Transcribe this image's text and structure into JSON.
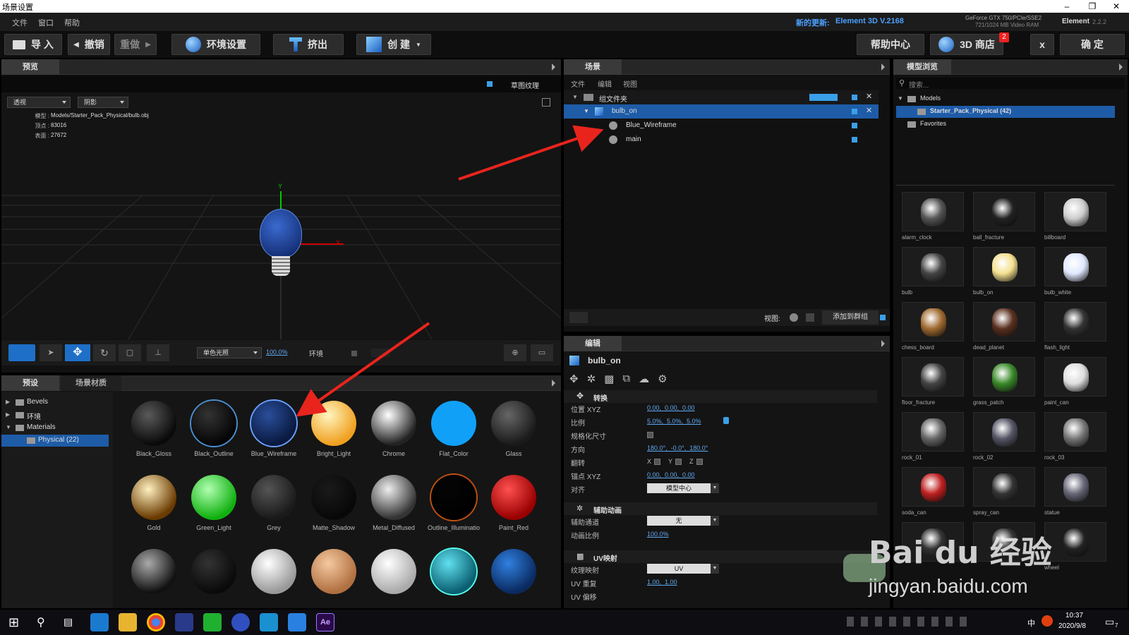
{
  "window": {
    "title": "场景设置",
    "min": "–",
    "restore": "❐",
    "close": "✕"
  },
  "menu": {
    "items": [
      "文件",
      "窗口",
      "帮助"
    ],
    "update_label": "新的更新:",
    "update_version": "Element 3D V.2168",
    "gpu_line1": "GeForce GTX 750/PCIe/SSE2",
    "gpu_line2": "721/1024 MB Video RAM",
    "app": "Element",
    "app_version": "2.2.2"
  },
  "toolbar": {
    "import": "导 入",
    "undo": "撤销",
    "redo": "重做",
    "env": "环境设置",
    "extrude": "挤出",
    "create": "创 建",
    "help": "帮助中心",
    "store": "3D 商店",
    "store_badge": "2",
    "close": "x",
    "ok": "确 定"
  },
  "preview": {
    "tab": "预览",
    "draft_texture": "草图纹理",
    "view_mode": "透视",
    "shadow_mode": "阴影",
    "info": [
      {
        "k": "模型 :",
        "v": "Models/Starter_Pack_Physical/bulb.obj"
      },
      {
        "k": "顶点 :",
        "v": "83016"
      },
      {
        "k": "表面 :",
        "v": "27672"
      }
    ],
    "axis_y": "Y",
    "axis_x": "X",
    "light_mode": "单色光照",
    "zoom": "100.0%",
    "env_label": "环境"
  },
  "presets": {
    "tabs": [
      "预设",
      "场景材质"
    ],
    "tree": [
      {
        "label": "Bevels",
        "open": false
      },
      {
        "label": "环境",
        "open": false
      },
      {
        "label": "Materials",
        "open": true
      },
      {
        "label": "Physical (22)",
        "child": true,
        "selected": true
      }
    ],
    "materials": [
      {
        "name": "Black_Gloss",
        "c1": "#5a5a5a",
        "c2": "#0a0a0a"
      },
      {
        "name": "Black_Outline",
        "c1": "#333",
        "c2": "#050505",
        "ring": "#4a8fd0"
      },
      {
        "name": "Blue_Wireframe",
        "c1": "#2a4e9a",
        "c2": "#0a1a40",
        "ring": "#6aa0ff"
      },
      {
        "name": "Bright_Light",
        "c1": "#fff5c0",
        "c2": "#f0a020"
      },
      {
        "name": "Chrome",
        "c1": "#ffffff",
        "c2": "#222"
      },
      {
        "name": "Flat_Color",
        "c1": "#10a0f8",
        "c2": "#10a0f8"
      },
      {
        "name": "Glass",
        "c1": "#666",
        "c2": "#1a1a1a"
      },
      {
        "name": "Gold",
        "c1": "#fff0c0",
        "c2": "#6a3a00"
      },
      {
        "name": "Green_Light",
        "c1": "#b0ffb0",
        "c2": "#10b010"
      },
      {
        "name": "Grey",
        "c1": "#555",
        "c2": "#1a1a1a"
      },
      {
        "name": "Matte_Shadow",
        "c1": "#1a1a1a",
        "c2": "#080808"
      },
      {
        "name": "Metal_Diffused",
        "c1": "#eee",
        "c2": "#333"
      },
      {
        "name": "Outline_Illuminatio",
        "c1": "#050505",
        "c2": "#000",
        "ring": "#c05010"
      },
      {
        "name": "Paint_Red",
        "c1": "#ff5050",
        "c2": "#900"
      },
      {
        "name": "",
        "c1": "#aaa",
        "c2": "#111"
      },
      {
        "name": "",
        "c1": "#333",
        "c2": "#0a0a0a"
      },
      {
        "name": "",
        "c1": "#fff",
        "c2": "#999"
      },
      {
        "name": "",
        "c1": "#f5c8a0",
        "c2": "#b07040"
      },
      {
        "name": "",
        "c1": "#fff",
        "c2": "#aaa"
      },
      {
        "name": "",
        "c1": "#60e0f0",
        "c2": "#0a6070",
        "ring": "#5fe"
      },
      {
        "name": "",
        "c1": "#3080e0",
        "c2": "#0a2a60"
      }
    ]
  },
  "scene": {
    "tab": "场景",
    "menus": [
      "文件",
      "编辑",
      "视图"
    ],
    "group": "组文件夹",
    "items": [
      {
        "label": "bulb_on",
        "level": 1,
        "selected": true
      },
      {
        "label": "Blue_Wireframe",
        "level": 2
      },
      {
        "label": "main",
        "level": 2
      }
    ],
    "view_label": "视图:",
    "add_group": "添加到群组"
  },
  "edit": {
    "tab": "编辑",
    "object": "bulb_on",
    "transform": "转换",
    "props": [
      {
        "k": "位置 XYZ",
        "v": "0.00,  0.00,  0.00"
      },
      {
        "k": "比例",
        "v": "5.0%,  5.0%,  5.0%"
      },
      {
        "k": "规格化尺寸",
        "v": ""
      },
      {
        "k": "方向",
        "v": "180.0°,  -0.0°,  180.0°"
      },
      {
        "k": "翻转",
        "v": ""
      },
      {
        "k": "锚点 XYZ",
        "v": "0.00,  0.00,  0.00"
      },
      {
        "k": "对齐",
        "v": "模型中心"
      }
    ],
    "flip": [
      "X",
      "Y",
      "Z"
    ],
    "aux": "辅助动画",
    "aux_props": [
      {
        "k": "辅助通道",
        "v": "无"
      },
      {
        "k": "动画比例",
        "v": "100.0%"
      }
    ],
    "uv": "UV映射",
    "uv_props": [
      {
        "k": "纹理映射",
        "v": "UV"
      },
      {
        "k": "UV 重复",
        "v": "1.00,  1.00"
      },
      {
        "k": "UV 偏移",
        "v": ""
      }
    ]
  },
  "browser": {
    "tab": "模型浏览器",
    "search": "搜索...",
    "tree": [
      {
        "label": "Models"
      },
      {
        "label": "Starter_Pack_Physical (42)",
        "selected": true
      },
      {
        "label": "Favorites"
      }
    ],
    "models": [
      "alarm_clock",
      "ball_fracture",
      "billboard",
      "bulb",
      "bulb_on",
      "bulb_white",
      "chess_board",
      "dead_planet",
      "flash_light",
      "floor_fracture",
      "grass_patch",
      "paint_can",
      "rock_01",
      "rock_02",
      "rock_03",
      "soda_can",
      "spray_can",
      "statue",
      "",
      "",
      "wheel"
    ]
  },
  "watermark": {
    "main": "Bai du 经验",
    "sub": "jingyan.baidu.com"
  },
  "taskbar": {
    "time": "10:37",
    "date": "2020/9/8",
    "ime": "中",
    "badge": "7"
  }
}
